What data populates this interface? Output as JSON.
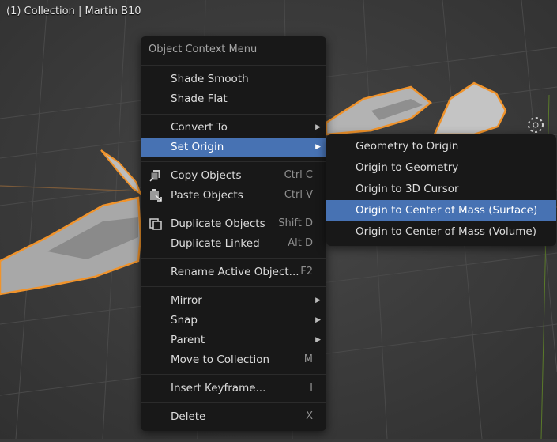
{
  "viewport": {
    "title": "(1) Collection | Martin B10"
  },
  "context_menu": {
    "header": "Object Context Menu",
    "items": [
      {
        "label": "Shade Smooth",
        "shortcut": "",
        "has_submenu": false,
        "active": false
      },
      {
        "label": "Shade Flat",
        "shortcut": "",
        "has_submenu": false,
        "active": false
      },
      {
        "label": "Convert To",
        "shortcut": "",
        "has_submenu": true,
        "active": false
      },
      {
        "label": "Set Origin",
        "shortcut": "",
        "has_submenu": true,
        "active": true
      },
      {
        "label": "Copy Objects",
        "shortcut": "Ctrl C",
        "icon": "copy-icon",
        "has_submenu": false,
        "active": false
      },
      {
        "label": "Paste Objects",
        "shortcut": "Ctrl V",
        "icon": "paste-icon",
        "has_submenu": false,
        "active": false
      },
      {
        "label": "Duplicate Objects",
        "shortcut": "Shift D",
        "icon": "duplicate-icon",
        "has_submenu": false,
        "active": false
      },
      {
        "label": "Duplicate Linked",
        "shortcut": "Alt D",
        "has_submenu": false,
        "active": false
      },
      {
        "label": "Rename Active Object...",
        "shortcut": "F2",
        "has_submenu": false,
        "active": false
      },
      {
        "label": "Mirror",
        "shortcut": "",
        "has_submenu": true,
        "active": false
      },
      {
        "label": "Snap",
        "shortcut": "",
        "has_submenu": true,
        "active": false
      },
      {
        "label": "Parent",
        "shortcut": "",
        "has_submenu": true,
        "active": false
      },
      {
        "label": "Move to Collection",
        "shortcut": "M",
        "has_submenu": false,
        "active": false
      },
      {
        "label": "Insert Keyframe...",
        "shortcut": "I",
        "has_submenu": false,
        "active": false
      },
      {
        "label": "Delete",
        "shortcut": "X",
        "has_submenu": false,
        "active": false
      }
    ]
  },
  "submenu": {
    "items": [
      {
        "label": "Geometry to Origin",
        "active": false
      },
      {
        "label": "Origin to Geometry",
        "active": false
      },
      {
        "label": "Origin to 3D Cursor",
        "active": false
      },
      {
        "label": "Origin to Center of Mass (Surface)",
        "active": true
      },
      {
        "label": "Origin to Center of Mass (Volume)",
        "active": false
      }
    ]
  },
  "colors": {
    "menu_bg": "#181818",
    "highlight": "#4772b3",
    "selection_outline": "#f0932b",
    "grid_x_axis": "#8a3a3a",
    "grid_y_axis": "#6a8a2a"
  }
}
